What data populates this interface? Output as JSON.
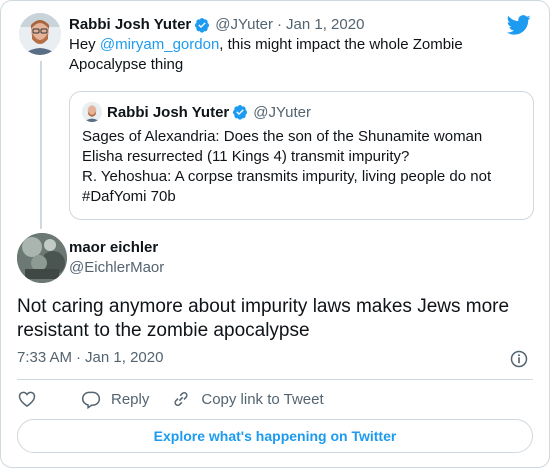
{
  "parent_tweet": {
    "author_name": "Rabbi Josh Yuter",
    "author_handle": "@JYuter",
    "date": "Jan 1, 2020",
    "text_before": "Hey ",
    "mention": "@miryam_gordon",
    "text_after": ", this might impact the whole Zombie Apocalypse thing"
  },
  "quoted_tweet": {
    "author_name": "Rabbi Josh Yuter",
    "author_handle": "@JYuter",
    "line1": "Sages of Alexandria: Does the son of the Shunamite woman Elisha resurrected (11 Kings 4) transmit impurity?",
    "line2": "R. Yehoshua: A corpse transmits impurity, living people do not #DafYomi 70b"
  },
  "main_tweet": {
    "author_name": "maor eichler",
    "author_handle": "@EichlerMaor",
    "text": "Not caring anymore about impurity laws makes Jews more resistant to the zombie apocalypse",
    "time": "7:33 AM",
    "date": "Jan 1, 2020"
  },
  "actions": {
    "reply_label": "Reply",
    "copy_link_label": "Copy link to Tweet"
  },
  "explore_label": "Explore what's happening on Twitter",
  "colors": {
    "accent": "#1d9bf0",
    "secondary_text": "#536471",
    "border": "#cfd9de"
  },
  "icons": [
    "twitter-bird-icon",
    "verified-badge-icon",
    "info-icon",
    "heart-icon",
    "reply-icon",
    "link-icon"
  ]
}
